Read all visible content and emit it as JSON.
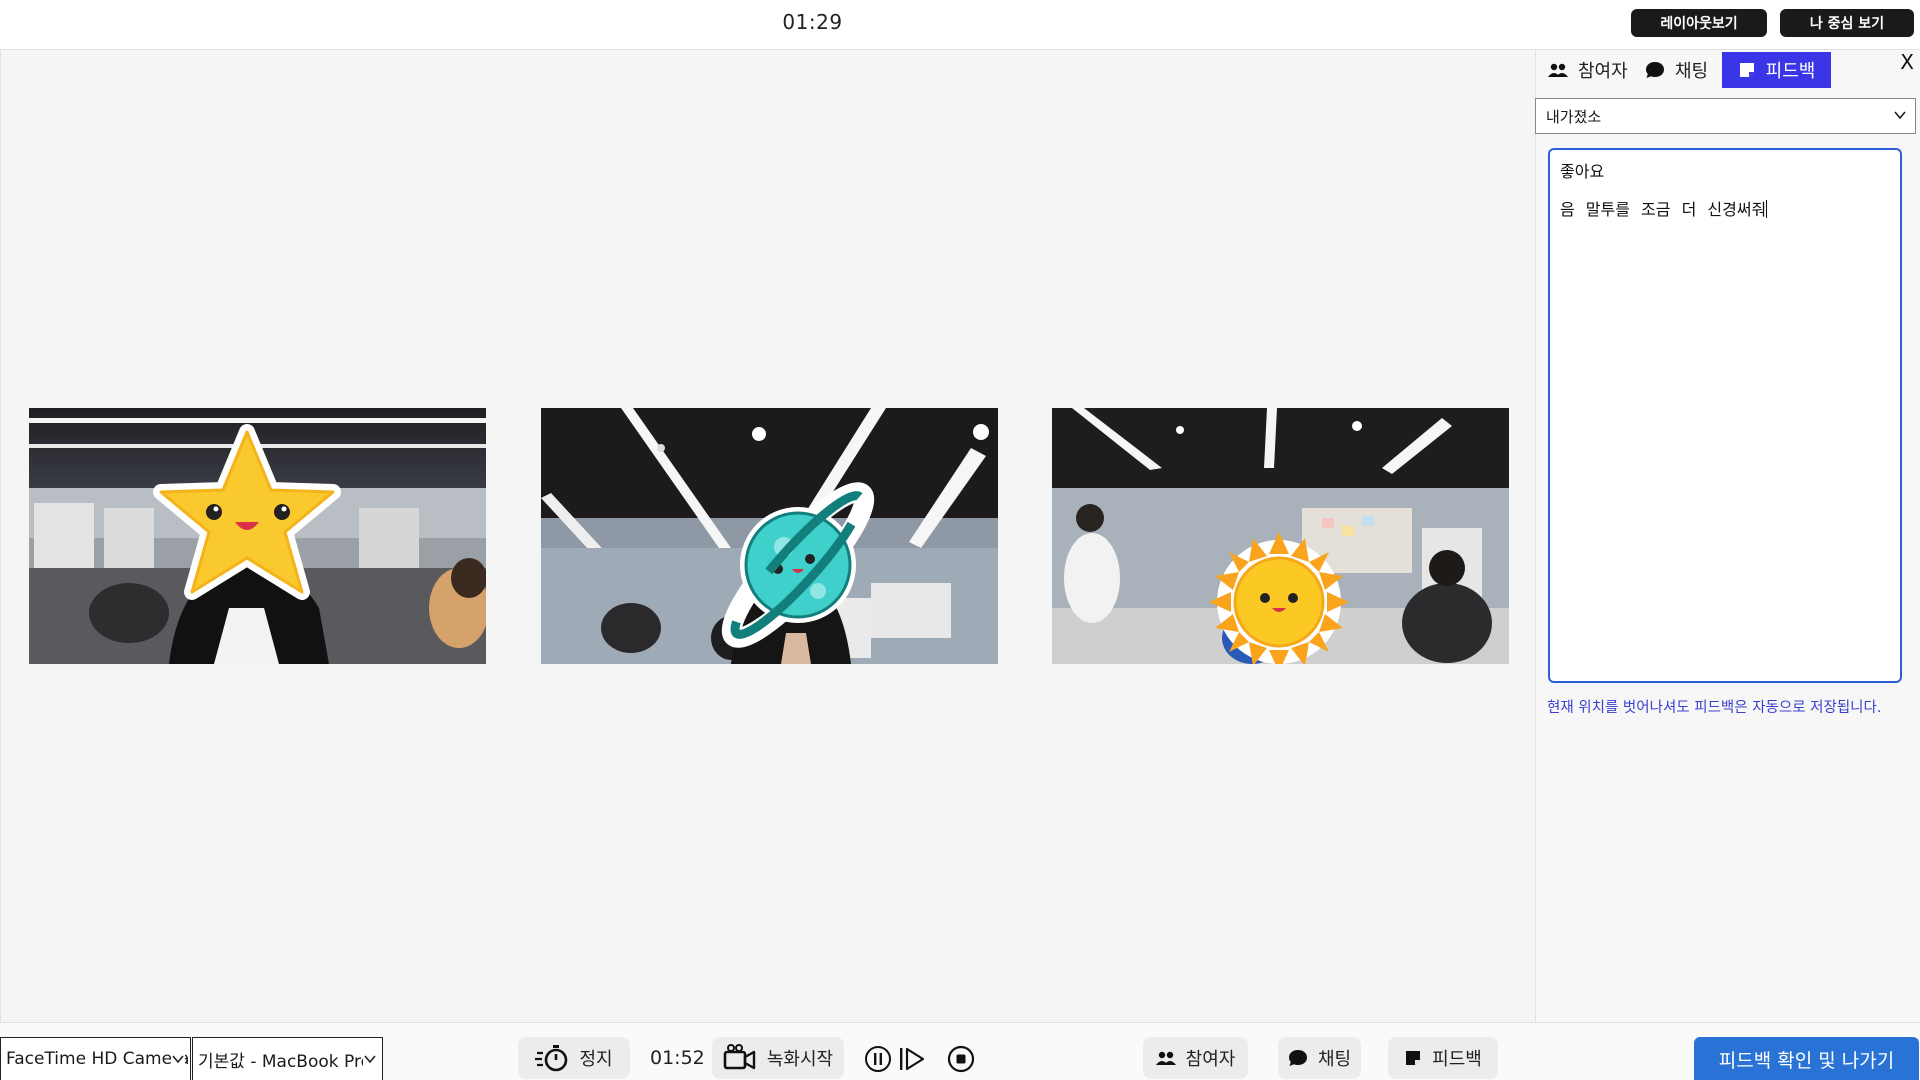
{
  "header": {
    "timer": "01:29",
    "layout_button": "레이아웃보기",
    "focus_button": "나 중심 보기"
  },
  "videos": [
    {
      "sticker": "star-sticker"
    },
    {
      "sticker": "planet-sticker"
    },
    {
      "sticker": "sun-sticker"
    }
  ],
  "panel": {
    "close_label": "X",
    "tabs": {
      "participants": "참여자",
      "chat": "채팅",
      "feedback": "피드백"
    },
    "active_tab": "feedback",
    "target_select": "내가졌소",
    "feedback_lines": [
      "좋아요",
      "음 말투를 조금 더 신경써줘"
    ],
    "autosave_hint": "현재 위치를 벗어나셔도 피드백은 자동으로 저장됩니다."
  },
  "bottombar": {
    "camera_select": "FaceTime HD Camera",
    "mic_select": "기본값 - MacBook Pro",
    "stop_label": "정지",
    "elapsed": "01:52",
    "record_label": "녹화시작",
    "participants_label": "참여자",
    "chat_label": "채팅",
    "feedback_label": "피드백",
    "exit_label": "피드백 확인 및 나가기"
  },
  "colors": {
    "accent_tab": "#3a36e8",
    "exit_button": "#2a73d6",
    "hint_text": "#3b3fd0",
    "textarea_border": "#2f5fd6"
  }
}
